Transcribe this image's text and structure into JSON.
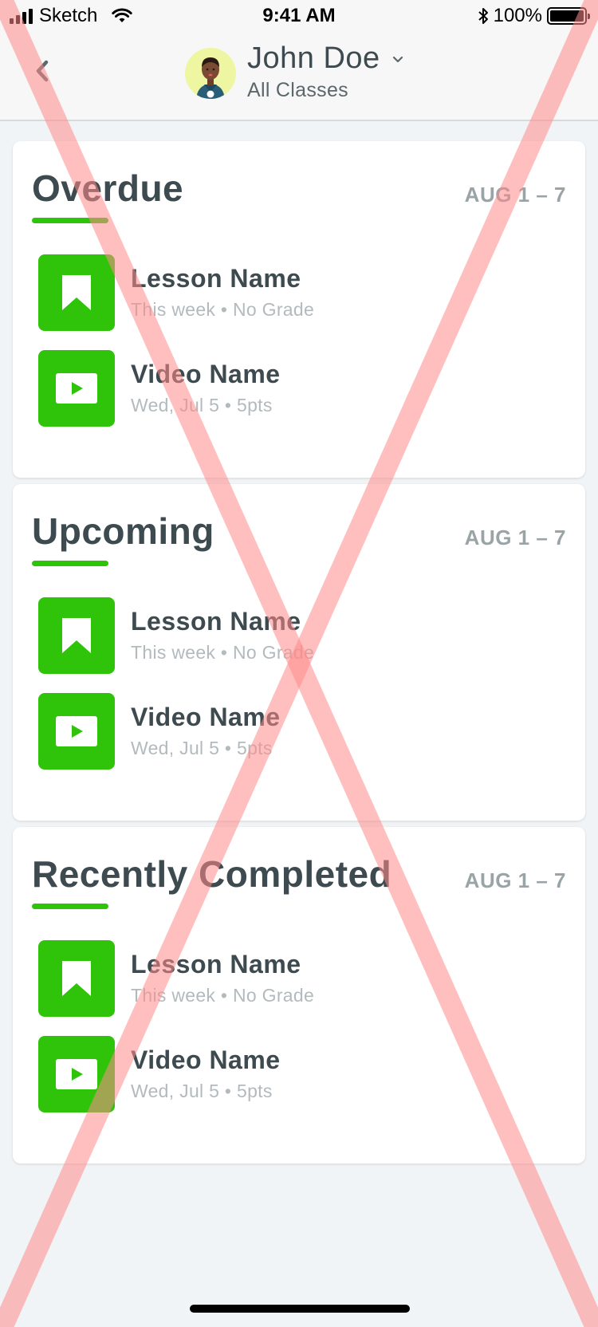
{
  "status_bar": {
    "carrier": "Sketch",
    "time": "9:41 AM",
    "battery_text": "100%",
    "battery_level": 1.0
  },
  "nav": {
    "back_icon": "chevron-left-icon",
    "user_name": "John Doe",
    "subtitle": "All Classes",
    "dropdown_icon": "chevron-down-icon"
  },
  "sections": [
    {
      "title": "Overdue",
      "date_range": "AUG 1 – 7",
      "items": [
        {
          "icon": "bookmark-icon",
          "title": "Lesson Name",
          "meta": "This week • No Grade"
        },
        {
          "icon": "play-icon",
          "title": "Video Name",
          "meta": "Wed, Jul 5 • 5pts"
        }
      ]
    },
    {
      "title": "Upcoming",
      "date_range": "AUG 1 – 7",
      "items": [
        {
          "icon": "bookmark-icon",
          "title": "Lesson Name",
          "meta": "This week • No Grade"
        },
        {
          "icon": "play-icon",
          "title": "Video Name",
          "meta": "Wed, Jul 5 • 5pts"
        }
      ]
    },
    {
      "title": "Recently Completed",
      "date_range": "AUG 1 – 7",
      "items": [
        {
          "icon": "bookmark-icon",
          "title": "Lesson Name",
          "meta": "This week • No Grade"
        },
        {
          "icon": "play-icon",
          "title": "Video Name",
          "meta": "Wed, Jul 5 • 5pts"
        }
      ]
    }
  ],
  "colors": {
    "accent_green": "#2fc40a",
    "overlay_red": "#ff8a8a",
    "avatar_bg": "#eef6a2"
  }
}
